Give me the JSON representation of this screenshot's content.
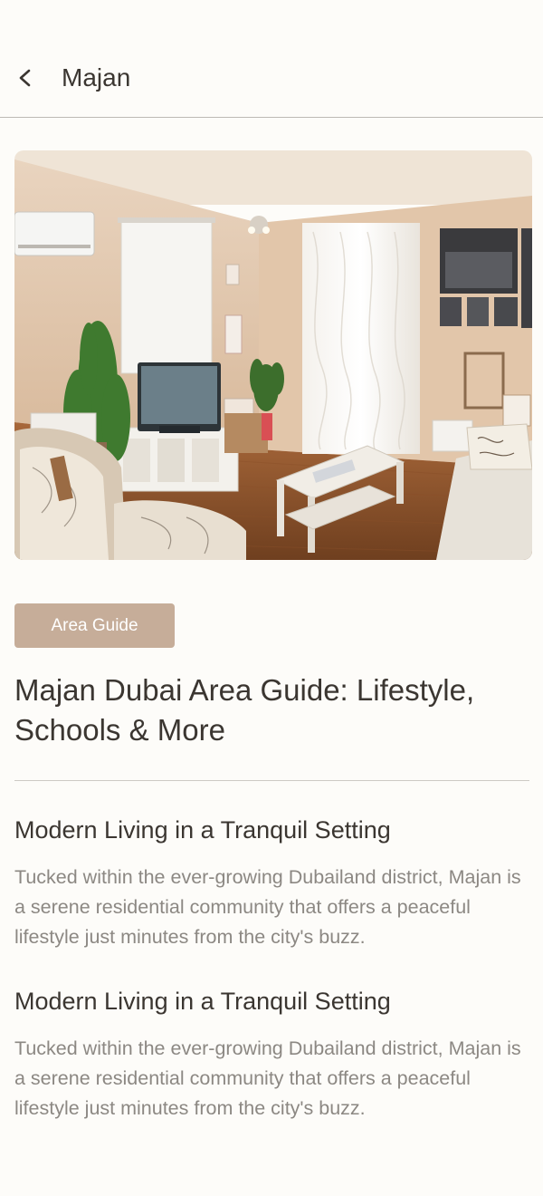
{
  "header": {
    "title": "Majan",
    "back_icon": "chevron-left-icon"
  },
  "hero": {
    "image_alt": "Living room interior"
  },
  "article": {
    "badge_label": "Area Guide",
    "title": "Majan Dubai Area Guide: Lifestyle, Schools & More",
    "sections": [
      {
        "heading": "Modern Living in a Tranquil Setting",
        "body": "Tucked within the ever-growing Dubailand district, Majan is a serene residential community that offers a peaceful lifestyle just minutes from the city's buzz."
      },
      {
        "heading": "Modern Living in a Tranquil Setting",
        "body": "Tucked within the ever-growing Dubailand district, Majan is a serene residential community that offers a peaceful lifestyle just minutes from the city's buzz."
      }
    ]
  },
  "colors": {
    "background": "#fdfcf9",
    "badge": "#c6ad99",
    "text_primary": "#3b3631",
    "text_secondary": "#8c8883"
  }
}
